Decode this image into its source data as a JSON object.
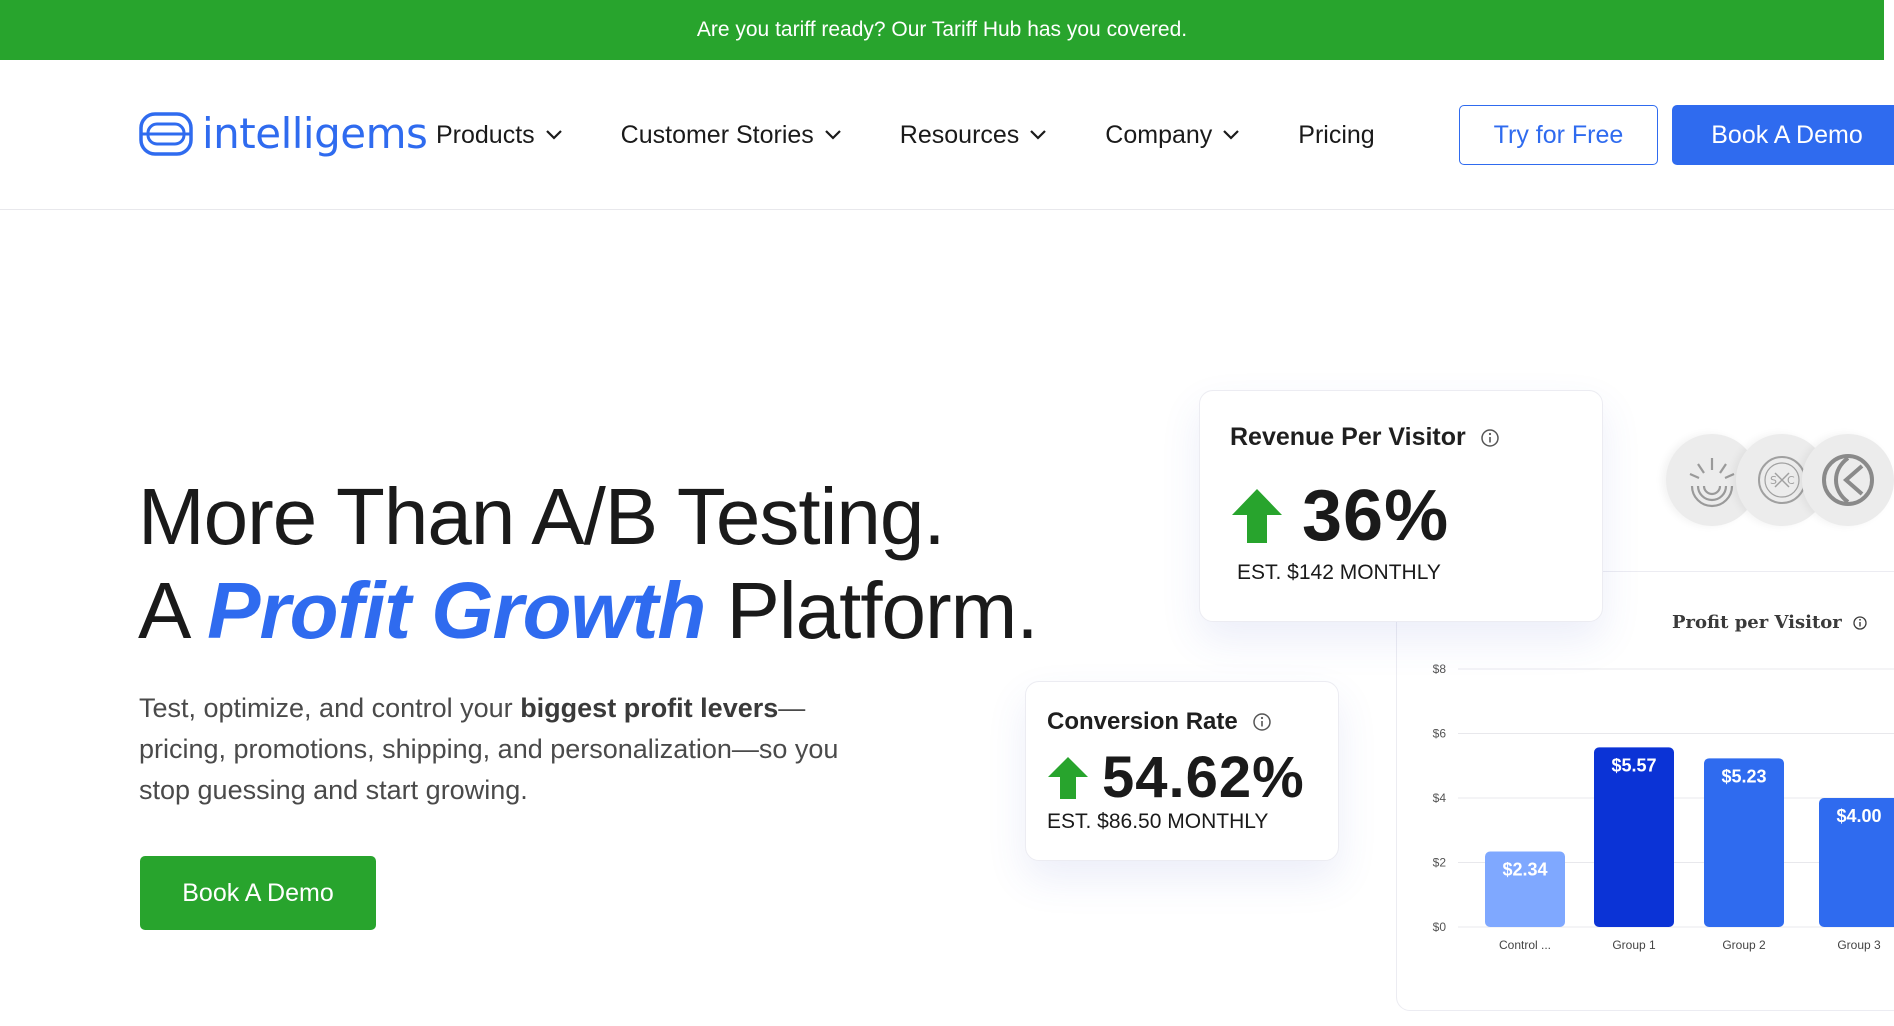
{
  "banner": {
    "text": "Are you tariff ready? Our Tariff Hub has you covered."
  },
  "brand": {
    "name": "intelligems",
    "accent": "#2f6bef",
    "green": "#28a42d"
  },
  "nav": {
    "items": [
      {
        "label": "Products",
        "dropdown": true
      },
      {
        "label": "Customer Stories",
        "dropdown": true
      },
      {
        "label": "Resources",
        "dropdown": true
      },
      {
        "label": "Company",
        "dropdown": true
      },
      {
        "label": "Pricing",
        "dropdown": false
      }
    ],
    "try_label": "Try for Free",
    "demo_label": "Book A Demo"
  },
  "hero": {
    "line1": "More Than A/B Testing.",
    "line2_prefix": "A ",
    "line2_highlight": "Profit Growth",
    "line2_suffix": " Platform.",
    "sub_pre": "Test, optimize, and control your ",
    "sub_bold": "biggest profit levers",
    "sub_post": "—pricing, promotions, shipping, and personalization—so you stop guessing and start growing.",
    "cta_label": "Book A Demo"
  },
  "rpv_card": {
    "title": "Revenue Per Visitor",
    "value": "36%",
    "est": "EST. $142 MONTHLY",
    "icon": "info-icon"
  },
  "cr_card": {
    "title": "Conversion Rate",
    "value": "54.62%",
    "est": "EST. $86.50 MONTHLY",
    "icon": "info-icon"
  },
  "customer_logos": [
    "sunrise-logo-icon",
    "sc-badge-logo-icon",
    "swirl-logo-icon"
  ],
  "chart_data": {
    "type": "bar",
    "title": "Profit per Visitor",
    "categories": [
      "Control ...",
      "Group 1",
      "Group 2",
      "Group 3"
    ],
    "values": [
      2.34,
      5.57,
      5.23,
      4.0
    ],
    "value_labels": [
      "$2.34",
      "$5.57",
      "$5.23",
      "$4.00"
    ],
    "colors": [
      "#7fa8ff",
      "#0b33d6",
      "#2f6bef",
      "#2f6bef"
    ],
    "yticks": [
      "$0",
      "$2",
      "$4",
      "$6",
      "$8"
    ],
    "ylim": [
      0,
      8
    ],
    "grid": true
  }
}
